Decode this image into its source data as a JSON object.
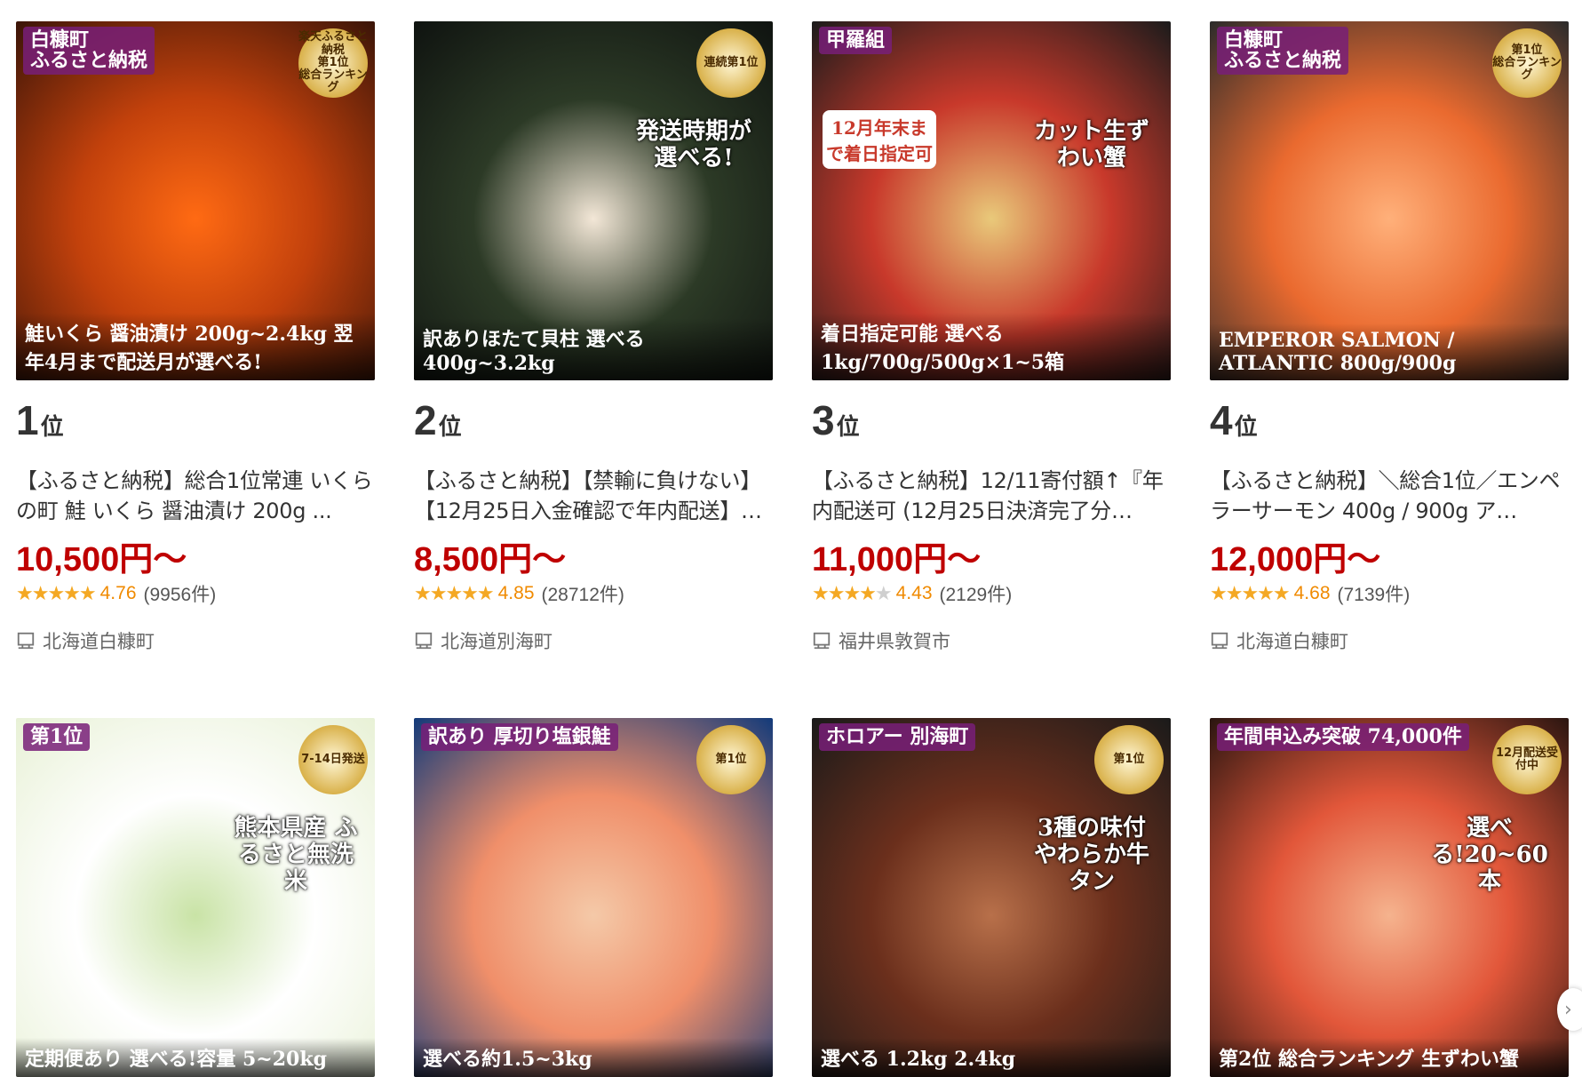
{
  "items": [
    {
      "rank_num": "1",
      "rank_unit": "位",
      "title": "【ふるさと納税】総合1位常連 いくらの町 鮭 いくら 醤油漬け 200g ...",
      "price": "10,500円〜",
      "stars": 4.76,
      "score": "4.76",
      "count": "(9956件)",
      "location": "北海道白糠町",
      "img": {
        "tl": "白糠町\nふるさと納税",
        "tr": "楽天ふるさと納税\n第1位\n総合ランキング",
        "bottom": "鮭いくら 醤油漬け 200g~2.4kg 翌年4月まで配送月が選べる!",
        "colors": [
          "#3a1408",
          "#c2410c",
          "#ff6a13"
        ]
      }
    },
    {
      "rank_num": "2",
      "rank_unit": "位",
      "title": "【ふるさと納税】【禁輸に負けない】【12月25日入金確認で年内配送】…",
      "price": "8,500円〜",
      "stars": 4.85,
      "score": "4.85",
      "count": "(28712件)",
      "location": "北海道別海町",
      "img": {
        "tl": "",
        "tr": "連続第1位",
        "side": "発送時期が選べる!",
        "bottom": "訳ありほたて貝柱 選べる400g~3.2kg",
        "colors": [
          "#0f1310",
          "#2c3a26",
          "#f3e7d7"
        ]
      }
    },
    {
      "rank_num": "3",
      "rank_unit": "位",
      "title": "【ふるさと納税】12/11寄付額↑『年内配送可 (12月25日決済完了分…",
      "price": "11,000円〜",
      "stars": 4.43,
      "score": "4.43",
      "count": "(2129件)",
      "location": "福井県敦賀市",
      "img": {
        "tl": "甲羅組",
        "tr": "",
        "side": "カット生ずわい蟹",
        "mid": "12月年末まで着日指定可",
        "bottom": "着日指定可能 選べる 1kg/700g/500g×1~5箱",
        "colors": [
          "#1b1b1b",
          "#c8392b",
          "#e9c97a"
        ]
      }
    },
    {
      "rank_num": "4",
      "rank_unit": "位",
      "title": "【ふるさと納税】＼総合1位／エンペラーサーモン 400g / 900g ア…",
      "price": "12,000円〜",
      "stars": 4.68,
      "score": "4.68",
      "count": "(7139件)",
      "location": "北海道白糠町",
      "img": {
        "tl": "白糠町\nふるさと納税",
        "tr": "第1位\n総合ランキング",
        "bottom": "EMPEROR SALMON / ATLANTIC 800g/900g",
        "colors": [
          "#2b2b2b",
          "#ea6a2f",
          "#ffb07a"
        ]
      }
    },
    {
      "img": {
        "tl": "第1位",
        "tr": "7-14日発送",
        "side": "熊本県産 ふるさと無洗米",
        "bottom": "定期便あり 選べる!容量 5~20kg",
        "colors": [
          "#e8f1d6",
          "#ffffff",
          "#c9e3a6"
        ]
      }
    },
    {
      "img": {
        "tl": "訳あり 厚切り塩銀鮭",
        "tr": "第1位",
        "bottom": "選べる約1.5~3kg",
        "colors": [
          "#123a7a",
          "#f08f6a",
          "#f4c9a8"
        ]
      }
    },
    {
      "img": {
        "tl": "ホロアー 別海町",
        "tr": "第1位",
        "side": "3種の味付 やわらか牛タン",
        "bottom": "選べる 1.2kg 2.4kg",
        "colors": [
          "#1a1a1a",
          "#6b2f1c",
          "#b8704a"
        ]
      }
    },
    {
      "img": {
        "tl": "年間申込み突破 74,000件",
        "tr": "12月配送受付中",
        "side": "選べる!20~60本",
        "bottom": "第2位 総合ランキング 生ずわい蟹",
        "colors": [
          "#2a1510",
          "#e2573a",
          "#f5b38e"
        ]
      }
    }
  ]
}
